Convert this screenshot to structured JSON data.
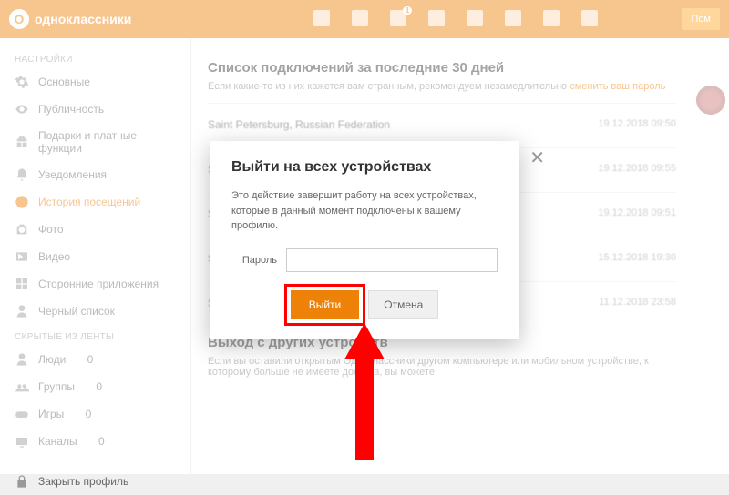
{
  "brand": {
    "name": "одноклассники"
  },
  "topnav": {
    "help": "Пом"
  },
  "sidebar": {
    "settings_label": "НАСТРОЙКИ",
    "items": [
      {
        "label": "Основные"
      },
      {
        "label": "Публичность"
      },
      {
        "label": "Подарки и платные функции"
      },
      {
        "label": "Уведомления"
      },
      {
        "label": "История посещений"
      },
      {
        "label": "Фото"
      },
      {
        "label": "Видео"
      },
      {
        "label": "Сторонние приложения"
      },
      {
        "label": "Черный список"
      }
    ],
    "hidden_label": "СКРЫТЫЕ ИЗ ЛЕНТЫ",
    "hidden": [
      {
        "label": "Люди",
        "count": "0"
      },
      {
        "label": "Группы",
        "count": "0"
      },
      {
        "label": "Игры",
        "count": "0"
      },
      {
        "label": "Каналы",
        "count": "0"
      }
    ],
    "close_profile": "Закрыть профиль"
  },
  "content": {
    "list_title": "Список подключений за последние 30 дней",
    "list_desc_a": "Если какие-то из них кажется вам странным, рекомендуем незамедлительно ",
    "list_desc_link": "сменить ваш пароль",
    "sessions": [
      {
        "loc": "Saint Petersburg, Russian Federation",
        "date": "19.12.2018 09:50"
      },
      {
        "loc": "Saint Petersburg, R",
        "date": "19.12.2018 09:55"
      },
      {
        "loc": "Saint Petersburg, R",
        "date": "19.12.2018 09:51"
      },
      {
        "loc": "Saint Petersburg, R",
        "date": "15.12.2018 19:30"
      },
      {
        "loc": "Saint Petersburg, Russian Federation",
        "date": "11.12.2018 23:58"
      }
    ],
    "logout_title": "Выход с других устройств",
    "logout_desc": "Если вы оставили открытым Одноклассники     другом компьютере или мобильном устройстве, к которому больше не имеете доступа, вы можете"
  },
  "modal": {
    "title": "Выйти на всех устройствах",
    "desc": "Это действие завершит работу на всех устройствах, которые в данный момент подключены к вашему профилю.",
    "password_label": "Пароль",
    "password_value": "",
    "submit": "Выйти",
    "cancel": "Отмена"
  },
  "colors": {
    "accent": "#ee8208",
    "highlight": "#ff0000"
  }
}
